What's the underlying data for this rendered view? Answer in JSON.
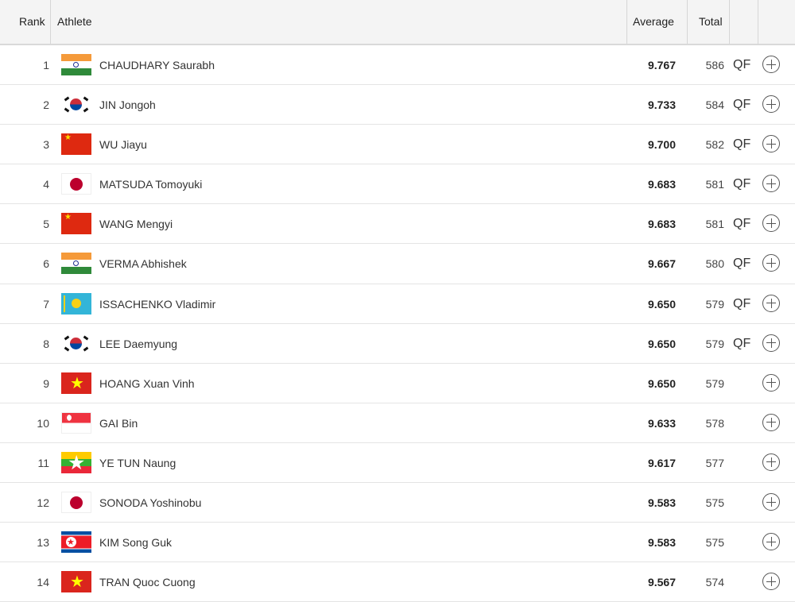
{
  "header": {
    "rank": "Rank",
    "athlete": "Athlete",
    "average": "Average",
    "total": "Total"
  },
  "colors": {
    "header_bg": "#f4f4f4",
    "row_divider": "#e4e4e4",
    "text": "#333333"
  },
  "rows": [
    {
      "rank": "1",
      "flag": "flag-india-icon",
      "name": "CHAUDHARY Saurabh",
      "average": "9.767",
      "total": "586",
      "qf": "QF"
    },
    {
      "rank": "2",
      "flag": "flag-korea-icon",
      "name": "JIN Jongoh",
      "average": "9.733",
      "total": "584",
      "qf": "QF"
    },
    {
      "rank": "3",
      "flag": "flag-china-icon",
      "name": "WU Jiayu",
      "average": "9.700",
      "total": "582",
      "qf": "QF"
    },
    {
      "rank": "4",
      "flag": "flag-japan-icon",
      "name": "MATSUDA Tomoyuki",
      "average": "9.683",
      "total": "581",
      "qf": "QF"
    },
    {
      "rank": "5",
      "flag": "flag-china-icon",
      "name": "WANG Mengyi",
      "average": "9.683",
      "total": "581",
      "qf": "QF"
    },
    {
      "rank": "6",
      "flag": "flag-india-icon",
      "name": "VERMA Abhishek",
      "average": "9.667",
      "total": "580",
      "qf": "QF"
    },
    {
      "rank": "7",
      "flag": "flag-kazakhstan-icon",
      "name": "ISSACHENKO Vladimir",
      "average": "9.650",
      "total": "579",
      "qf": "QF"
    },
    {
      "rank": "8",
      "flag": "flag-korea-icon",
      "name": "LEE Daemyung",
      "average": "9.650",
      "total": "579",
      "qf": "QF"
    },
    {
      "rank": "9",
      "flag": "flag-vietnam-icon",
      "name": "HOANG Xuan Vinh",
      "average": "9.650",
      "total": "579",
      "qf": ""
    },
    {
      "rank": "10",
      "flag": "flag-singapore-icon",
      "name": "GAI Bin",
      "average": "9.633",
      "total": "578",
      "qf": ""
    },
    {
      "rank": "11",
      "flag": "flag-myanmar-icon",
      "name": "YE TUN Naung",
      "average": "9.617",
      "total": "577",
      "qf": ""
    },
    {
      "rank": "12",
      "flag": "flag-japan-icon",
      "name": "SONODA Yoshinobu",
      "average": "9.583",
      "total": "575",
      "qf": ""
    },
    {
      "rank": "13",
      "flag": "flag-north-korea-icon",
      "name": "KIM Song Guk",
      "average": "9.583",
      "total": "575",
      "qf": ""
    },
    {
      "rank": "14",
      "flag": "flag-vietnam-icon",
      "name": "TRAN Quoc Cuong",
      "average": "9.567",
      "total": "574",
      "qf": ""
    }
  ]
}
